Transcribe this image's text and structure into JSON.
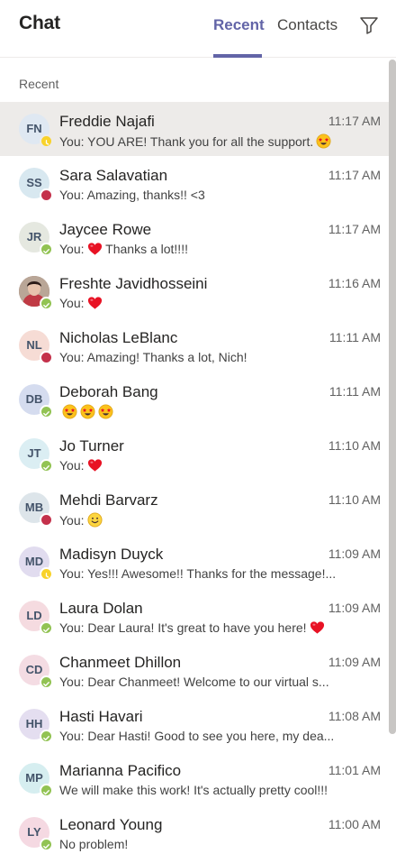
{
  "header": {
    "title": "Chat",
    "tabs": [
      {
        "label": "Recent",
        "active": true
      },
      {
        "label": "Contacts",
        "active": false
      }
    ],
    "filter_icon": "filter-icon",
    "accent_color": "#6264a7"
  },
  "section_label": "Recent",
  "chats": [
    {
      "initials": "FN",
      "name": "Freddie Najafi",
      "time": "11:17 AM",
      "preview": "You: YOU ARE! Thank you for all the support.",
      "emoji": [
        "star-struck"
      ],
      "presence": "away",
      "avatar_bg": "#dfe8f2",
      "selected": true
    },
    {
      "initials": "SS",
      "name": "Sara Salavatian",
      "time": "11:17 AM",
      "preview": "You: Amazing, thanks!! <3",
      "emoji": [],
      "presence": "busy",
      "avatar_bg": "#d8e8f0"
    },
    {
      "initials": "JR",
      "name": "Jaycee Rowe",
      "time": "11:17 AM",
      "preview": "You:",
      "emoji": [
        "heart"
      ],
      "preview_after": " Thanks a lot!!!!",
      "presence": "available",
      "avatar_bg": "#e5e8e0"
    },
    {
      "initials": "",
      "name": "Freshte Javidhosseini",
      "time": "11:16 AM",
      "preview": "You:",
      "emoji": [
        "heart"
      ],
      "presence": "available",
      "avatar_bg": "#8a5a4a",
      "photo": true
    },
    {
      "initials": "NL",
      "name": "Nicholas LeBlanc",
      "time": "11:11 AM",
      "preview": "You: Amazing! Thanks a lot, Nich!",
      "emoji": [],
      "presence": "busy",
      "avatar_bg": "#f6dcd5"
    },
    {
      "initials": "DB",
      "name": "Deborah Bang",
      "time": "11:11 AM",
      "preview": "",
      "emoji": [
        "star-struck",
        "star-struck",
        "star-struck"
      ],
      "presence": "available",
      "avatar_bg": "#d5dcef"
    },
    {
      "initials": "JT",
      "name": "Jo Turner",
      "time": "11:10 AM",
      "preview": "You:",
      "emoji": [
        "heart"
      ],
      "presence": "available",
      "avatar_bg": "#dbeef3"
    },
    {
      "initials": "MB",
      "name": "Mehdi Barvarz",
      "time": "11:10 AM",
      "preview": "You:",
      "emoji": [
        "smile"
      ],
      "presence": "busy",
      "avatar_bg": "#dde5ea"
    },
    {
      "initials": "MD",
      "name": "Madisyn Duyck",
      "time": "11:09 AM",
      "preview": "You: Yes!!! Awesome!! Thanks for the message!...",
      "emoji": [],
      "presence": "away",
      "avatar_bg": "#e1dcef"
    },
    {
      "initials": "LD",
      "name": "Laura Dolan",
      "time": "11:09 AM",
      "preview": "You: Dear Laura! It's great to have you here!",
      "emoji": [
        "heart"
      ],
      "presence": "available",
      "avatar_bg": "#f5dbe0"
    },
    {
      "initials": "CD",
      "name": "Chanmeet Dhillon",
      "time": "11:09 AM",
      "preview": "You: Dear Chanmeet! Welcome to our virtual s...",
      "emoji": [],
      "presence": "available",
      "avatar_bg": "#f4dce3"
    },
    {
      "initials": "HH",
      "name": "Hasti Havari",
      "time": "11:08 AM",
      "preview": "You: Dear Hasti! Good to see you here, my dea...",
      "emoji": [],
      "presence": "available",
      "avatar_bg": "#e4def0"
    },
    {
      "initials": "MP",
      "name": "Marianna Pacifico",
      "time": "11:01 AM",
      "preview": "We will make this work! It's actually pretty cool!!!",
      "emoji": [],
      "presence": "available",
      "avatar_bg": "#d6eef0"
    },
    {
      "initials": "LY",
      "name": "Leonard Young",
      "time": "11:00 AM",
      "preview": "No problem!",
      "emoji": [],
      "presence": "available",
      "avatar_bg": "#f5d9e2"
    }
  ]
}
